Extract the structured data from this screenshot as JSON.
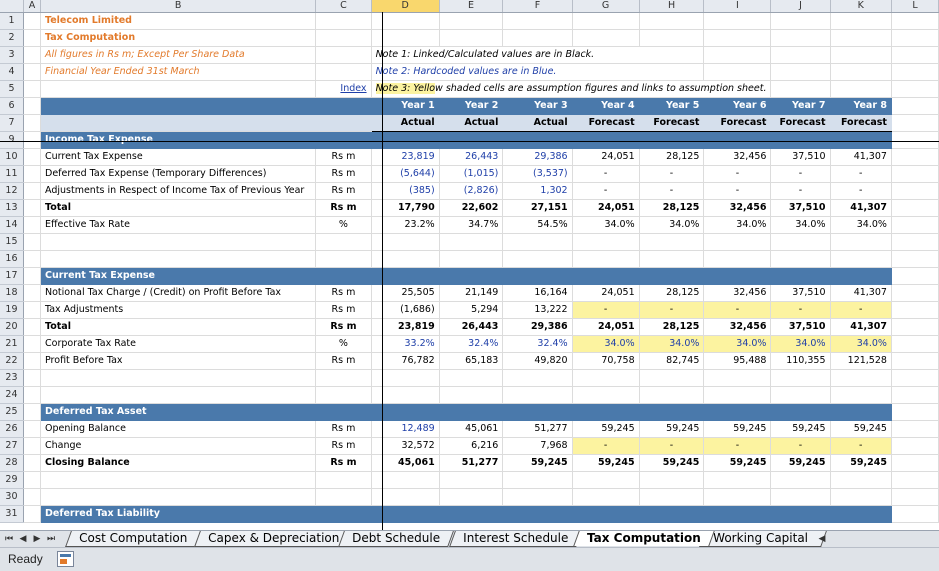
{
  "columns": [
    "",
    "A",
    "B",
    "C",
    "D",
    "E",
    "F",
    "G",
    "H",
    "I",
    "J",
    "K",
    "L"
  ],
  "header": {
    "title": "Telecom Limited",
    "subtitle": "Tax Computation",
    "figures_note": "All figures in Rs m; Except Per Share Data",
    "fy_note": "Financial Year Ended 31st March",
    "index_link": "Index",
    "note1": "Note 1: Linked/Calculated values are in Black.",
    "note2": "Note 2: Hardcoded values are in Blue.",
    "note3_highlight": "Note 3: Yello",
    "note3_rest": "w shaded cells are assumption figures and links to assumption sheet."
  },
  "years": [
    "Year 1",
    "Year 2",
    "Year 3",
    "Year 4",
    "Year 5",
    "Year 6",
    "Year 7",
    "Year 8"
  ],
  "year_types": [
    "Actual",
    "Actual",
    "Actual",
    "Forecast",
    "Forecast",
    "Forecast",
    "Forecast",
    "Forecast"
  ],
  "sections": {
    "income_tax": {
      "title": "Income Tax Expense",
      "rows": [
        {
          "label": "Current Tax Expense",
          "unit": "Rs m",
          "values": [
            "23,819",
            "26,443",
            "29,386",
            "24,051",
            "28,125",
            "32,456",
            "37,510",
            "41,307"
          ]
        },
        {
          "label": "Deferred Tax Expense (Temporary Differences)",
          "unit": "Rs m",
          "values": [
            "(5,644)",
            "(1,015)",
            "(3,537)",
            "-",
            "-",
            "-",
            "-",
            "-"
          ]
        },
        {
          "label": "Adjustments in Respect of Income Tax of Previous Year",
          "unit": "Rs m",
          "values": [
            "(385)",
            "(2,826)",
            "1,302",
            "-",
            "-",
            "-",
            "-",
            "-"
          ]
        },
        {
          "label": "Total",
          "unit": "Rs m",
          "values": [
            "17,790",
            "22,602",
            "27,151",
            "24,051",
            "28,125",
            "32,456",
            "37,510",
            "41,307"
          ]
        },
        {
          "label": "Effective Tax Rate",
          "unit": "%",
          "values": [
            "23.2%",
            "34.7%",
            "54.5%",
            "34.0%",
            "34.0%",
            "34.0%",
            "34.0%",
            "34.0%"
          ]
        }
      ]
    },
    "current_tax": {
      "title": "Current Tax Expense",
      "rows": [
        {
          "label": "Notional Tax Charge / (Credit) on Profit Before Tax",
          "unit": "Rs m",
          "values": [
            "25,505",
            "21,149",
            "16,164",
            "24,051",
            "28,125",
            "32,456",
            "37,510",
            "41,307"
          ]
        },
        {
          "label": "Tax Adjustments",
          "unit": "Rs m",
          "values": [
            "(1,686)",
            "5,294",
            "13,222",
            "-",
            "-",
            "-",
            "-",
            "-"
          ]
        },
        {
          "label": "Total",
          "unit": "Rs m",
          "values": [
            "23,819",
            "26,443",
            "29,386",
            "24,051",
            "28,125",
            "32,456",
            "37,510",
            "41,307"
          ]
        },
        {
          "label": "Corporate Tax Rate",
          "unit": "%",
          "values": [
            "33.2%",
            "32.4%",
            "32.4%",
            "34.0%",
            "34.0%",
            "34.0%",
            "34.0%",
            "34.0%"
          ]
        },
        {
          "label": "Profit Before Tax",
          "unit": "Rs m",
          "values": [
            "76,782",
            "65,183",
            "49,820",
            "70,758",
            "82,745",
            "95,488",
            "110,355",
            "121,528"
          ]
        }
      ]
    },
    "deferred_asset": {
      "title": "Deferred Tax Asset",
      "rows": [
        {
          "label": "Opening Balance",
          "unit": "Rs m",
          "values": [
            "12,489",
            "45,061",
            "51,277",
            "59,245",
            "59,245",
            "59,245",
            "59,245",
            "59,245"
          ]
        },
        {
          "label": "Change",
          "unit": "Rs m",
          "values": [
            "32,572",
            "6,216",
            "7,968",
            "-",
            "-",
            "-",
            "-",
            "-"
          ]
        },
        {
          "label": "Closing Balance",
          "unit": "Rs m",
          "values": [
            "45,061",
            "51,277",
            "59,245",
            "59,245",
            "59,245",
            "59,245",
            "59,245",
            "59,245"
          ]
        }
      ]
    },
    "deferred_liability": {
      "title": "Deferred Tax Liability"
    }
  },
  "sheet_tabs": [
    "Cost Computation",
    "Capex & Depreciation",
    "Debt Schedule",
    "Interest Schedule",
    "Tax Computation",
    "Working Capital"
  ],
  "active_tab": "Tax Computation",
  "status": {
    "ready": "Ready"
  },
  "colors": {
    "band": "#4a79ab",
    "subband": "#d5dfec",
    "assumption": "#fcf3a0",
    "hardcoded": "#1f3fa8",
    "title": "#e27a2b"
  }
}
